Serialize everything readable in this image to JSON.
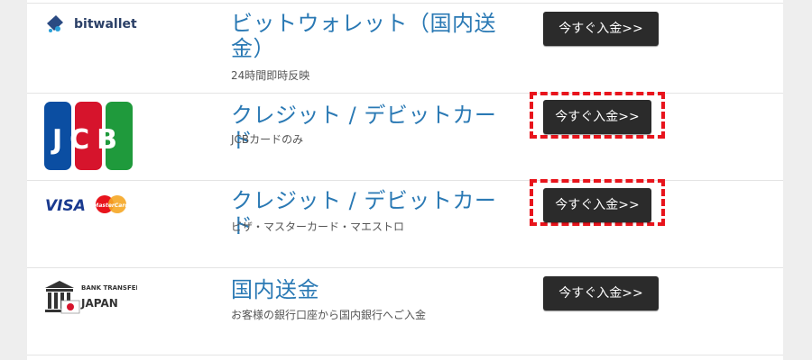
{
  "methods": [
    {
      "logo_text": "bitwallet",
      "title": "ビットウォレット（国内送金）",
      "subtitle": "24時間即時反映",
      "button": "今すぐ入金>>",
      "highlighted": false
    },
    {
      "logo_text": "JCB",
      "title": "クレジット / デビットカード",
      "subtitle": "JCBカードのみ",
      "button": "今すぐ入金>>",
      "highlighted": true
    },
    {
      "logo_text": "VISA",
      "logo_text_2": "MasterCard",
      "title": "クレジット / デビットカード",
      "subtitle": "ビザ・マスターカード・マエストロ",
      "button": "今すぐ入金>>",
      "highlighted": true
    },
    {
      "logo_text": "BANK TRANSFER",
      "logo_text_2": "JAPAN",
      "title": "国内送金",
      "subtitle": "お客様の銀行口座から国内銀行へご入金",
      "button": "今すぐ入金>>",
      "highlighted": false
    }
  ],
  "colors": {
    "title": "#2a79b4",
    "button_bg": "#2b2b2b",
    "highlight": "#e8141c"
  }
}
